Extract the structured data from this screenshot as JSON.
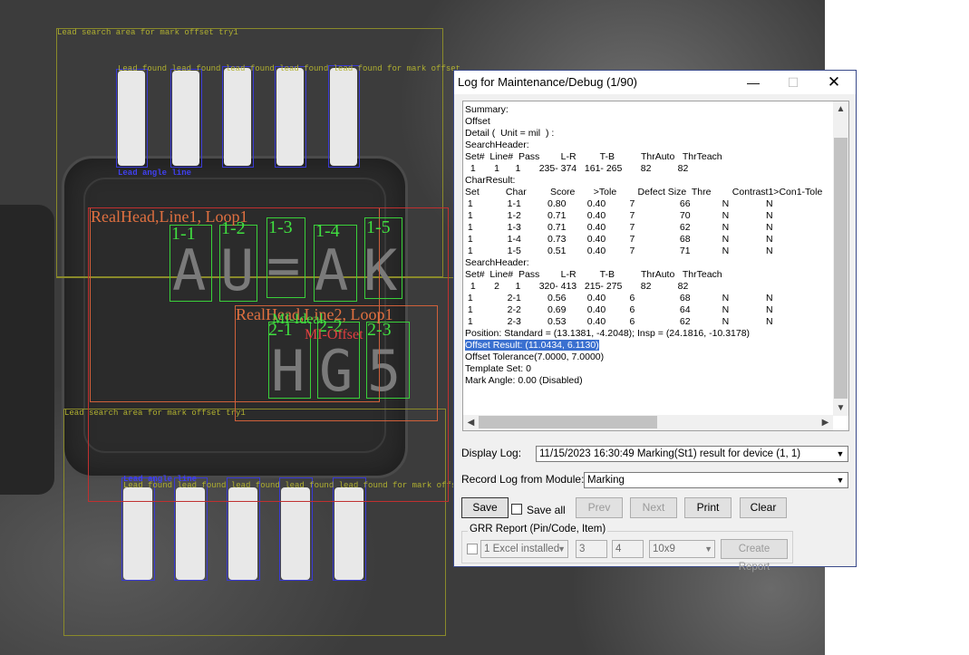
{
  "overlay": {
    "lead_search_top": "Lead search area for mark offset try1",
    "lead_search_bottom": "Lead search area for mark offset try1",
    "lead_found_top": "Lead found lead found lead found lead found lead found for mark offset",
    "lead_found_bottom": "Lead found lead found lead found lead found lead found for mark offset",
    "lead_angle_top": "Lead angle line",
    "lead_angle_bottom": "Lead angle line",
    "real_head_line1": "RealHead,Line1, Loop1",
    "real_head_line2": "RealHead,Line2, Loop1",
    "char_labels_line1": [
      "1-1",
      "1-2",
      "1-3",
      "1-4",
      "1-5"
    ],
    "char_labels_line2": [
      "2-1",
      "2-2",
      "2-3"
    ],
    "mark_glyphs_line1": [
      "A",
      "U",
      "=",
      "A",
      "K"
    ],
    "mark_glyphs_line2": [
      "H",
      "G",
      "5"
    ],
    "mi_ideal": "MI-Ideal",
    "mi_offset": "MI-Offset"
  },
  "dialog": {
    "title": "Log for Maintenance/Debug (1/90)",
    "minimize_icon": "minimize-icon",
    "maximize_icon": "maximize-icon",
    "close_icon": "close-icon",
    "log_lines": [
      "Summary:",
      "Offset",
      "Detail (  Unit = mil  ) :",
      "SearchHeader:",
      "Set#  Line#  Pass        L-R         T-B          ThrAuto   ThrTeach",
      "  1       1      1       235- 374   161- 265       82          82",
      "CharResult:",
      "Set          Char         Score       >Tole        Defect Size  Thre        Contrast1>Con1-Tole",
      " 1             1-1          0.80        0.40         7                 66            N              N",
      " 1             1-2          0.71        0.40         7                 70            N              N",
      " 1             1-3          0.71        0.40         7                 62            N              N",
      " 1             1-4          0.73        0.40         7                 68            N              N",
      " 1             1-5          0.51        0.40         7                 71            N              N",
      "SearchHeader:",
      "Set#  Line#  Pass        L-R         T-B          ThrAuto   ThrTeach",
      "  1       2      1       320- 413   215- 275       82          82",
      " 1             2-1          0.56        0.40         6                 68            N              N",
      " 1             2-2          0.69        0.40         6                 64            N              N",
      " 1             2-3          0.53        0.40         6                 62            N              N",
      "Position: Standard = (13.1381, -4.2048); Insp = (24.1816, -10.3178)",
      "Offset Result: (11.0434, 6.1130)",
      "Offset Tolerance(7.0000, 7.0000)",
      "Template Set: 0",
      "Mark Angle: 0.00 (Disabled)"
    ],
    "highlighted_line_index": 20,
    "display_log_label": "Display Log:",
    "display_log_value": "11/15/2023 16:30:49 Marking(St1) result for device (1, 1)",
    "record_log_label": "Record Log from Module:",
    "record_log_value": "Marking",
    "save_label": "Save",
    "save_all_label": "Save all",
    "prev_label": "Prev",
    "next_label": "Next",
    "print_label": "Print",
    "clear_label": "Clear",
    "grr_label": "GRR Report (Pin/Code, Item)",
    "grr_excel_value": "1 Excel installed",
    "grr_field1": "3",
    "grr_field2": "4",
    "grr_grid_value": "10x9",
    "create_report_label": "Create Report"
  }
}
